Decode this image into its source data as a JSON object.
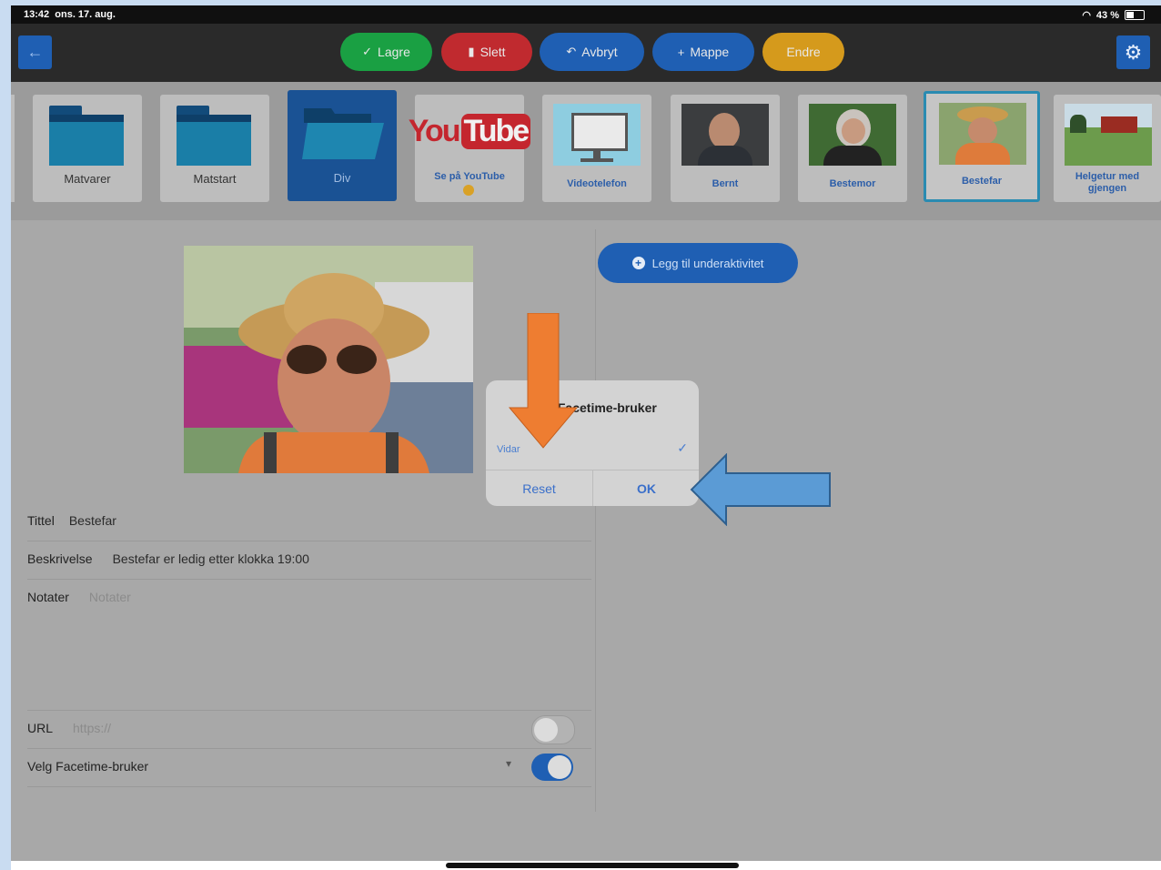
{
  "status_bar": {
    "time": "13:42",
    "date": "ons. 17. aug.",
    "battery": "43 %"
  },
  "toolbar": {
    "back_icon": "arrow-left-icon",
    "buttons": [
      {
        "label": "Lagre",
        "icon": "check-icon",
        "color": "#1aa043"
      },
      {
        "label": "Slett",
        "icon": "trash-icon",
        "color": "#c02a2f"
      },
      {
        "label": "Avbryt",
        "icon": "undo-icon",
        "color": "#1f5fb3"
      },
      {
        "label": "Mappe",
        "icon": "plus-icon",
        "color": "#1f5fb3"
      },
      {
        "label": "Endre",
        "icon": "",
        "color": "#d59a1c"
      }
    ],
    "settings_icon": "gear-icon"
  },
  "strip": {
    "tiles": [
      {
        "label": "Matvarer",
        "kind": "folder"
      },
      {
        "label": "Matstart",
        "kind": "folder"
      },
      {
        "label": "Div",
        "kind": "folder-selected"
      },
      {
        "label": "Se på YouTube",
        "kind": "youtube"
      },
      {
        "label": "Videotelefon",
        "kind": "image"
      },
      {
        "label": "Bernt",
        "kind": "image"
      },
      {
        "label": "Bestemor",
        "kind": "image"
      },
      {
        "label": "Bestefar",
        "kind": "image-selected"
      },
      {
        "label": "Helgetur med gjengen",
        "kind": "image"
      }
    ],
    "youtube_logo_left": "You",
    "youtube_logo_right": "Tube"
  },
  "form": {
    "title_label": "Tittel",
    "title_value": "Bestefar",
    "description_label": "Beskrivelse",
    "description_value": "Bestefar er ledig etter klokka 19:00",
    "notes_label": "Notater",
    "notes_placeholder": "Notater",
    "url_label": "URL",
    "url_placeholder": "https://",
    "url_toggle_on": false,
    "facetime_label": "Velg Facetime-bruker",
    "facetime_toggle_on": true
  },
  "add_subactivity_label": "Legg til underaktivitet",
  "dialog": {
    "title": "Velg Facetime-bruker",
    "option": "Vidar",
    "option_selected": true,
    "reset_label": "Reset",
    "ok_label": "OK"
  },
  "colors": {
    "accent_blue": "#1f5fb3",
    "annotation_orange": "#ee7d31",
    "annotation_blue": "#5b9bd5"
  }
}
